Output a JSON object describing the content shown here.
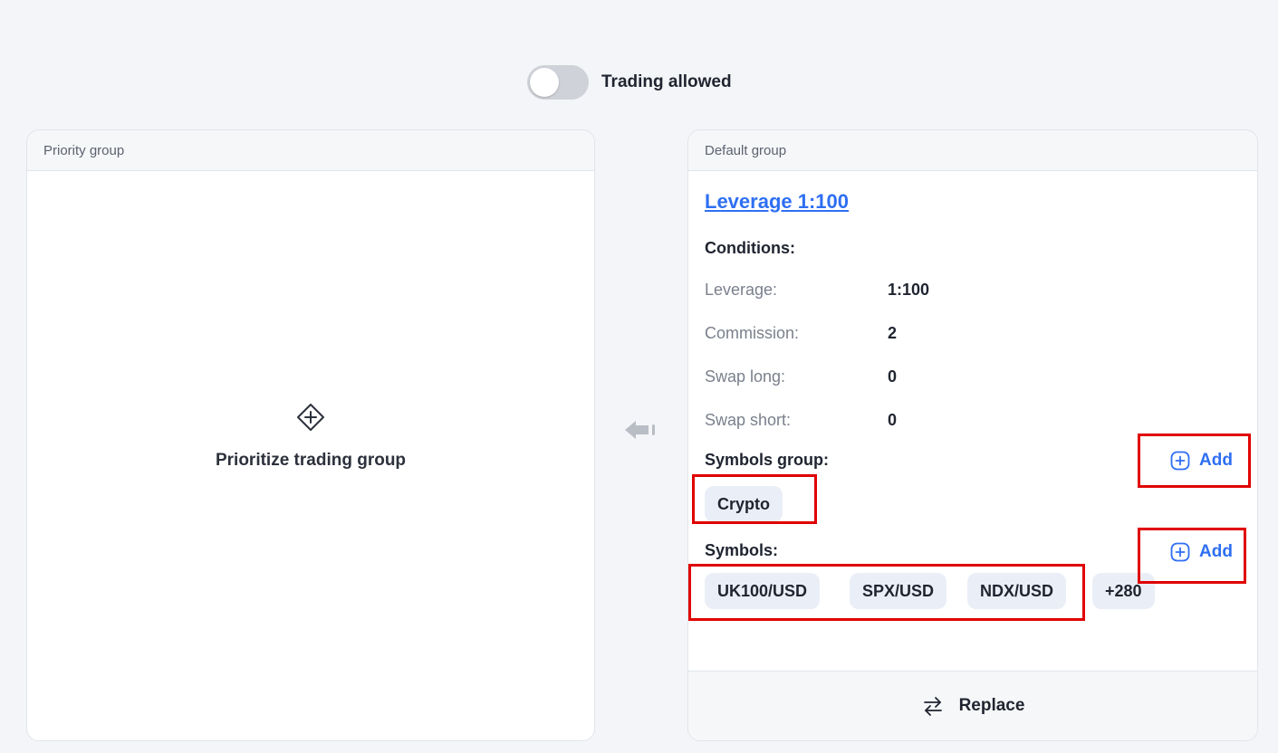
{
  "toggle": {
    "label": "Trading allowed",
    "checked": false
  },
  "priority_group": {
    "header": "Priority group",
    "action_label": "Prioritize trading group",
    "icon": "diamond-plus-icon"
  },
  "move_icon": "arrow-left-icon",
  "default_group": {
    "header": "Default group",
    "group_link": "Leverage 1:100",
    "conditions_title": "Conditions:",
    "conditions": [
      {
        "label": "Leverage:",
        "value": "1:100"
      },
      {
        "label": "Commission:",
        "value": "2"
      },
      {
        "label": "Swap long:",
        "value": "0"
      },
      {
        "label": "Swap short:",
        "value": "0"
      }
    ],
    "symbols_group_title": "Symbols group:",
    "symbols_group_add": "Add",
    "symbols_groups": [
      "Crypto"
    ],
    "symbols_title": "Symbols:",
    "symbols_add": "Add",
    "symbols": [
      "UK100/USD",
      "SPX/USD",
      "NDX/USD"
    ],
    "symbols_more": "+280",
    "replace_label": "Replace",
    "replace_icon": "swap-arrows-icon"
  },
  "colors": {
    "accent": "#2e6ff2",
    "highlight": "#e00000"
  }
}
